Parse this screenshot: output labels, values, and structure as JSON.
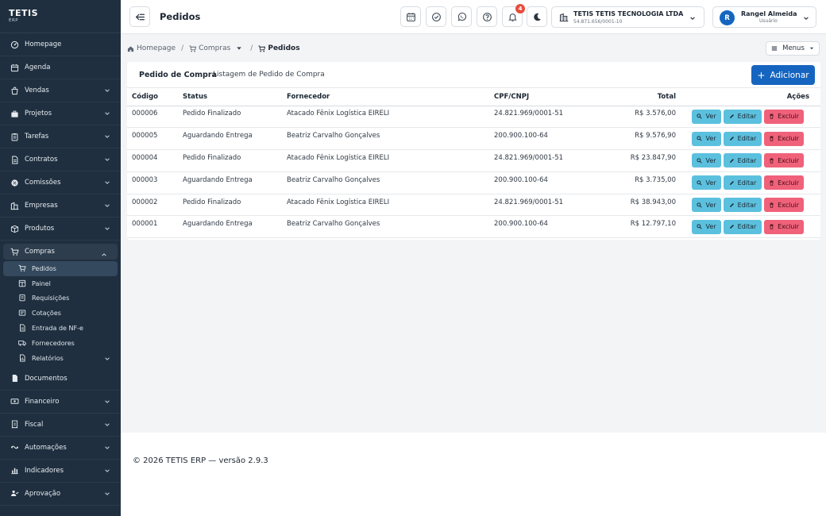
{
  "app": {
    "logo_main": "TETIS",
    "logo_sub": "ERP"
  },
  "sidebar": {
    "items": [
      {
        "label": "Homepage",
        "icon": "dashboard-icon",
        "has_children": false
      },
      {
        "label": "Agenda",
        "icon": "calendar-icon",
        "has_children": false
      },
      {
        "label": "Vendas",
        "icon": "sales-icon",
        "has_children": true
      },
      {
        "label": "Projetos",
        "icon": "projects-icon",
        "has_children": true
      },
      {
        "label": "Tarefas",
        "icon": "tasks-icon",
        "has_children": true
      },
      {
        "label": "Contratos",
        "icon": "contract-icon",
        "has_children": true
      },
      {
        "label": "Comissões",
        "icon": "commission-icon",
        "has_children": true
      },
      {
        "label": "Empresas",
        "icon": "building-icon",
        "has_children": true
      },
      {
        "label": "Produtos",
        "icon": "box-icon",
        "has_children": true
      },
      {
        "label": "Compras",
        "icon": "cart-icon",
        "has_children": true,
        "expanded": true
      },
      {
        "label": "Documentos",
        "icon": "document-icon",
        "has_children": false
      },
      {
        "label": "Financeiro",
        "icon": "money-icon",
        "has_children": true
      },
      {
        "label": "Fiscal",
        "icon": "receipt-icon",
        "has_children": true
      },
      {
        "label": "Automações",
        "icon": "automation-icon",
        "has_children": true
      },
      {
        "label": "Indicadores",
        "icon": "chart-icon",
        "has_children": true
      },
      {
        "label": "Aprovação",
        "icon": "approval-icon",
        "has_children": true
      }
    ],
    "compras_sub": [
      {
        "label": "Pedidos",
        "icon": "cart-check-icon",
        "current": true
      },
      {
        "label": "Painel",
        "icon": "panel-icon"
      },
      {
        "label": "Requisições",
        "icon": "request-icon"
      },
      {
        "label": "Cotações",
        "icon": "quote-icon"
      },
      {
        "label": "Entrada de NF-e",
        "icon": "invoice-icon"
      },
      {
        "label": "Fornecedores",
        "icon": "truck-icon"
      },
      {
        "label": "Relatórios",
        "icon": "report-icon",
        "has_children": true
      }
    ]
  },
  "topbar": {
    "title": "Pedidos",
    "notifications_count": "4",
    "company_name": "TETIS TETIS TECNOLOGIA LTDA",
    "company_cnpj": "54.871.656/0001-10",
    "user_initial": "R",
    "user_name": "Rangel Almeida",
    "user_role": "Usuário"
  },
  "breadcrumb": {
    "home": "Homepage",
    "compras": "Compras",
    "current": "Pedidos",
    "menus": "Menus"
  },
  "card": {
    "title": "Pedido de Compra",
    "subtitle": "Listagem de Pedido de Compra",
    "add_label": "Adicionar"
  },
  "table": {
    "headers": [
      "Código",
      "Status",
      "Fornecedor",
      "CPF/CNPJ",
      "Total",
      "Ações"
    ],
    "rows": [
      {
        "codigo": "000006",
        "status": "Pedido Finalizado",
        "fornecedor": "Atacado Fênix Logística EIRELI",
        "doc": "24.821.969/0001-51",
        "total": "R$ 3.576,00"
      },
      {
        "codigo": "000005",
        "status": "Aguardando Entrega",
        "fornecedor": "Beatriz Carvalho Gonçalves",
        "doc": "200.900.100-64",
        "total": "R$ 9.576,90"
      },
      {
        "codigo": "000004",
        "status": "Pedido Finalizado",
        "fornecedor": "Atacado Fênix Logística EIRELI",
        "doc": "24.821.969/0001-51",
        "total": "R$ 23.847,90"
      },
      {
        "codigo": "000003",
        "status": "Aguardando Entrega",
        "fornecedor": "Beatriz Carvalho Gonçalves",
        "doc": "200.900.100-64",
        "total": "R$ 3.735,00"
      },
      {
        "codigo": "000002",
        "status": "Pedido Finalizado",
        "fornecedor": "Atacado Fênix Logística EIRELI",
        "doc": "24.821.969/0001-51",
        "total": "R$ 38.943,00"
      },
      {
        "codigo": "000001",
        "status": "Aguardando Entrega",
        "fornecedor": "Beatriz Carvalho Gonçalves",
        "doc": "200.900.100-64",
        "total": "R$ 12.797,10"
      }
    ],
    "actions": {
      "view": "Ver",
      "edit": "Editar",
      "delete": "Excluir"
    }
  },
  "footer": {
    "text": "© 2026 TETIS ERP — versão 2.9.3"
  },
  "colors": {
    "sidebar_bg": "#1f2f3f",
    "primary": "#1565c0",
    "info": "#5bc0de",
    "danger": "#f0617a",
    "badge": "#e74c3c"
  }
}
